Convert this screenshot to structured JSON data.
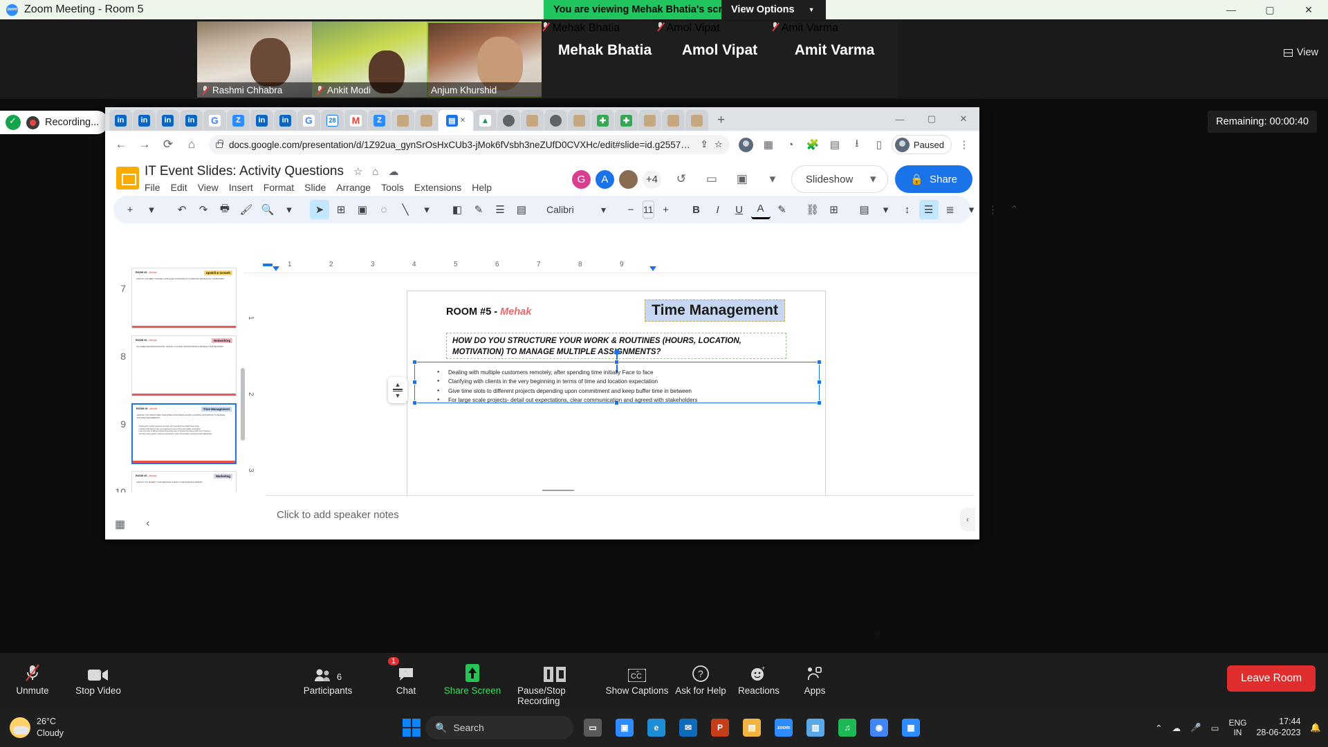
{
  "window": {
    "title": "Zoom Meeting - Room 5",
    "viewing_banner": "You are viewing Mehak Bhatia's screen",
    "view_options": "View Options",
    "view_options_caret": "▼",
    "minimize": "—",
    "maximize": "▢",
    "close": "✕"
  },
  "video_strip": {
    "view_label": "View",
    "tiles": [
      {
        "name": "Rashmi Chhabra",
        "has_video": true,
        "active": false
      },
      {
        "name": "Ankit Modi",
        "has_video": true,
        "active": false
      },
      {
        "name": "Anjum Khurshid",
        "has_video": true,
        "active": true
      },
      {
        "name": "Mehak Bhatia",
        "has_video": false,
        "active": false
      },
      {
        "name": "Amol Vipat",
        "has_video": false,
        "active": false
      },
      {
        "name": "Amit Varma",
        "has_video": false,
        "active": false
      }
    ]
  },
  "recording": {
    "label": "Recording...",
    "remaining": "Remaining: 00:00:40"
  },
  "browser": {
    "tabs": [
      {
        "favicon": "linkedin-icon",
        "glyph": "in",
        "cls": "li"
      },
      {
        "favicon": "linkedin-icon",
        "glyph": "in",
        "cls": "li"
      },
      {
        "favicon": "linkedin-icon",
        "glyph": "in",
        "cls": "li"
      },
      {
        "favicon": "linkedin-icon",
        "glyph": "in",
        "cls": "li"
      },
      {
        "favicon": "google-icon",
        "glyph": "G",
        "cls": "g"
      },
      {
        "favicon": "zoom-icon",
        "glyph": "Z",
        "cls": "z"
      },
      {
        "favicon": "linkedin-icon",
        "glyph": "in",
        "cls": "li"
      },
      {
        "favicon": "linkedin-icon",
        "glyph": "in",
        "cls": "li"
      },
      {
        "favicon": "google-icon",
        "glyph": "G",
        "cls": "g"
      },
      {
        "favicon": "google-calendar-icon",
        "glyph": "28",
        "cls": "cal"
      },
      {
        "favicon": "gmail-icon",
        "glyph": "M",
        "cls": "gm"
      },
      {
        "favicon": "zoom-icon",
        "glyph": "Z",
        "cls": "z"
      },
      {
        "favicon": "generic-site-icon",
        "glyph": "",
        "cls": "bug"
      },
      {
        "favicon": "generic-site-icon",
        "glyph": "",
        "cls": "bug"
      },
      {
        "favicon": "google-slides-icon",
        "glyph": "▤",
        "cls": "sheet"
      },
      {
        "favicon": "google-drive-icon",
        "glyph": "▲",
        "cls": "dr"
      },
      {
        "favicon": "globe-icon",
        "glyph": "",
        "cls": "gy"
      },
      {
        "favicon": "generic-site-icon",
        "glyph": "",
        "cls": "bug"
      },
      {
        "favicon": "globe-icon",
        "glyph": "",
        "cls": "gy"
      },
      {
        "favicon": "generic-site-icon",
        "glyph": "",
        "cls": "bug"
      },
      {
        "favicon": "plus-green-icon",
        "glyph": "✚",
        "cls": "pl"
      },
      {
        "favicon": "plus-green-icon",
        "glyph": "✚",
        "cls": "pl"
      },
      {
        "favicon": "generic-site-icon",
        "glyph": "",
        "cls": "bug"
      },
      {
        "favicon": "generic-site-icon",
        "glyph": "",
        "cls": "bug"
      },
      {
        "favicon": "generic-site-icon",
        "glyph": "",
        "cls": "bug"
      }
    ],
    "selected_tab_index": 14,
    "close_tab": "✕",
    "new_tab": "+",
    "win_min": "—",
    "win_max": "▢",
    "win_close": "✕",
    "back": "←",
    "forward": "→",
    "reload": "⟳",
    "home": "⌂",
    "url": "docs.google.com/presentation/d/1Z92ua_gynSrOsHxCUb3-jMok6fVsbh3neZUfD0CVXHc/edit#slide=id.g2557…",
    "share_icon": "⇪",
    "bookmark_icon": "☆",
    "profile_label": "Paused",
    "menu_icon": "⋮"
  },
  "slides": {
    "doc_title": "IT Event Slides: Activity Questions",
    "title_icons": [
      "star-icon",
      "move-to-folder-icon",
      "cloud-saved-icon"
    ],
    "menus": [
      "File",
      "Edit",
      "View",
      "Insert",
      "Format",
      "Slide",
      "Arrange",
      "Tools",
      "Extensions",
      "Help"
    ],
    "collaborators": [
      "G",
      "A",
      "",
      "+4"
    ],
    "history_icon": "↺",
    "comment_icon": "▭",
    "meet_icon": "▣",
    "slideshow_label": "Slideshow",
    "slideshow_caret": "▾",
    "share_label": "Share",
    "share_icon": "🔒",
    "toolbar": {
      "add_label": "+",
      "add_caret": "▾",
      "undo": "↶",
      "redo": "↷",
      "print": "🖶",
      "paint": "🖌",
      "zoom": "🔍",
      "zoom_caret": "▾",
      "select": "➤",
      "textbox": "⊞",
      "image": "▣",
      "shape": "◌",
      "line": "╲",
      "line_caret": "▾",
      "fill": "◧",
      "border_color": "✎",
      "border_weight": "☰",
      "border_dash": "▤",
      "font_name": "Calibri",
      "font_caret": "▾",
      "font_size_minus": "−",
      "font_size": "11",
      "font_size_plus": "+",
      "bold": "B",
      "italic": "I",
      "underline": "U",
      "text_color": "A",
      "highlight": "✎",
      "link": "⛓",
      "comment": "⊞",
      "align": "▤",
      "align_caret": "▾",
      "line_spacing": "↕",
      "bulleted_list": "☰",
      "numbered_list": "≣",
      "list_caret": "▾",
      "more": "⋮",
      "collapse": "⌃"
    }
  },
  "filmstrip": {
    "slides": [
      {
        "number": "7",
        "room": "ROOM #5 - ",
        "presenter": "Mehak",
        "badge": "Upskill & Growth",
        "badge_bg": "#ffd966",
        "badge_color": "#111",
        "question": "HOW DO YOU KEEP YOURSELF UPSKILLED & GROWING IN A CHANGING TECHNOLOGY LANDSCAPE?",
        "bar_color": "#ea5b5b",
        "selected": false
      },
      {
        "number": "8",
        "room": "ROOM #5 - ",
        "presenter": "Mehak",
        "badge": "Networking",
        "badge_bg": "#f4b8c6",
        "badge_color": "#111",
        "question": "AS A FREELANCER/CONSULTANT, HOW DO YOU FIND OPPORTUNITIES & MANAGE YOUR NETWORK?",
        "bar_color": "#ea5b5b",
        "selected": false
      },
      {
        "number": "9",
        "room": "ROOM #5 - ",
        "presenter": "Mehak",
        "badge": "Time Management",
        "badge_bg": "#c5d7f2",
        "badge_color": "#111",
        "question": "HOW DO YOU STRUCTURE YOUR WORK & ROUTINES (HOURS, LOCATION, MOTIVATION) TO MANAGE MULTIPLE ASSIGNMENTS?",
        "bar_color": "#ef5350",
        "selected": true
      },
      {
        "number": "10",
        "room": "ROOM #5 - ",
        "presenter": "Mehak",
        "badge": "Marketing",
        "badge_bg": "#d9d2e9",
        "badge_color": "#111",
        "question": "HOW DO YOU MARKET YOUR SERVICES & BUILD YOUR PERSONAL BRAND?",
        "bar_color": "#ea5b5b",
        "selected": false
      }
    ]
  },
  "slide_canvas": {
    "room_label": "ROOM #5 - ",
    "presenter": "Mehak",
    "title": "Time Management",
    "question": "HOW DO YOU STRUCTURE YOUR WORK & ROUTINES (HOURS, LOCATION, MOTIVATION) TO MANAGE MULTIPLE ASSIGNMENTS?",
    "bullets": [
      "Dealing with multiple customers remotely, after spending time initially Face to face",
      "Clarifying with clients in the very beginning in terms of time and location expectation",
      "Give time slots to different projects depending upon commitment and keep buffer time in between",
      "For large scale projects- detail out expectations, clear communication and agreed with stakeholders"
    ]
  },
  "ruler": {
    "h_ticks": [
      "1",
      "2",
      "3",
      "4",
      "5",
      "6",
      "7",
      "8",
      "9"
    ],
    "v_ticks": [
      "1",
      "2",
      "3"
    ]
  },
  "notes": {
    "placeholder": "Click to add speaker notes",
    "grid_view_icon": "▦",
    "collapse_icon": "‹",
    "right_panel_icon": "‹"
  },
  "zoom_toolbar": {
    "items": [
      {
        "label": "Unmute",
        "icon": "mic-muted-icon",
        "green": false,
        "caret": true,
        "badge": ""
      },
      {
        "label": "Stop Video",
        "icon": "video-icon",
        "green": false,
        "caret": true,
        "badge": ""
      },
      {
        "label": "Participants",
        "icon": "participants-icon",
        "green": false,
        "caret": false,
        "badge": "",
        "count": "6"
      },
      {
        "label": "Chat",
        "icon": "chat-icon",
        "green": false,
        "caret": true,
        "badge": "1"
      },
      {
        "label": "Share Screen",
        "icon": "share-screen-icon",
        "green": true,
        "caret": false,
        "badge": ""
      },
      {
        "label": "Pause/Stop Recording",
        "icon": "pause-stop-recording-icon",
        "green": false,
        "caret": false,
        "badge": ""
      },
      {
        "label": "Show Captions",
        "icon": "closed-captions-icon",
        "green": false,
        "caret": true,
        "badge": ""
      },
      {
        "label": "Ask for Help",
        "icon": "question-mark-icon",
        "green": false,
        "caret": false,
        "badge": ""
      },
      {
        "label": "Reactions",
        "icon": "reactions-icon",
        "green": false,
        "caret": false,
        "badge": ""
      },
      {
        "label": "Apps",
        "icon": "apps-icon",
        "green": false,
        "caret": false,
        "badge": ""
      }
    ],
    "leave_label": "Leave Room"
  },
  "taskbar": {
    "weather_temp": "26°C",
    "weather_desc": "Cloudy",
    "search_placeholder": "Search",
    "search_icon": "search-icon",
    "apps": [
      {
        "name": "task-view-icon",
        "glyph": "▭",
        "bg": "#5a5a5a"
      },
      {
        "name": "zoom-meetings-icon",
        "glyph": "▣",
        "bg": "#2d8cff"
      },
      {
        "name": "edge-icon",
        "glyph": "e",
        "bg": "#1d8fd6"
      },
      {
        "name": "outlook-icon",
        "glyph": "✉",
        "bg": "#0f6cbd"
      },
      {
        "name": "powerpoint-icon",
        "glyph": "P",
        "bg": "#c43e1c"
      },
      {
        "name": "file-explorer-icon",
        "glyph": "▤",
        "bg": "#f2b441"
      },
      {
        "name": "zoom-icon",
        "glyph": "zoom",
        "bg": "#2d8cff"
      },
      {
        "name": "notepad-icon",
        "glyph": "▥",
        "bg": "#5aa9e6"
      },
      {
        "name": "spotify-icon",
        "glyph": "♫",
        "bg": "#1db954"
      },
      {
        "name": "chrome-icon",
        "glyph": "◉",
        "bg": "#4285f4"
      },
      {
        "name": "calendar-icon",
        "glyph": "▦",
        "bg": "#2d8cff"
      }
    ],
    "tray_caret": "⌃",
    "tray_icons": [
      "cloud-sync-icon",
      "mic-icon",
      "battery-icon"
    ],
    "lang_line1": "ENG",
    "lang_line2": "IN",
    "time": "17:44",
    "date": "28-06-2023",
    "notification_icon": "🔔"
  }
}
